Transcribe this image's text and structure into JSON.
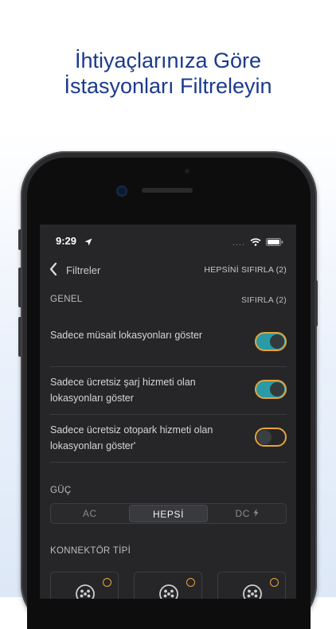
{
  "headline": {
    "line1": "İhtiyaçlarınıza Göre",
    "line2": "İstasyonları Filtreleyin"
  },
  "status_bar": {
    "time": "9:29",
    "signal": "....",
    "icons": [
      "location-arrow-icon",
      "signal-dots-icon",
      "wifi-icon",
      "battery-icon"
    ]
  },
  "nav": {
    "title": "Filtreler",
    "reset_all": "HEPSİNİ SIFIRLA (2)"
  },
  "general": {
    "header": "GENEL",
    "reset": "SIFIRLA (2)",
    "items": [
      {
        "label": "Sadece müsait lokasyonları göster",
        "on": true
      },
      {
        "label": "Sadece ücretsiz şarj hizmeti olan lokasyonları göster",
        "on": true
      },
      {
        "label": "Sadece ücretsiz otopark hizmeti olan lokasyonları göster'",
        "on": false
      }
    ]
  },
  "power": {
    "header": "GÜÇ",
    "options": [
      "AC",
      "HEPSİ",
      "DC"
    ],
    "selected": "HEPSİ"
  },
  "connector": {
    "header": "KONNEKTÖR TİPİ",
    "icons": [
      "connector-type-icon",
      "connector-type-icon",
      "connector-type-icon"
    ]
  },
  "colors": {
    "headline": "#1a3a8c",
    "toggle_on": "#2a9aa6",
    "accent": "#e6a43a",
    "screen_bg": "#262628"
  }
}
